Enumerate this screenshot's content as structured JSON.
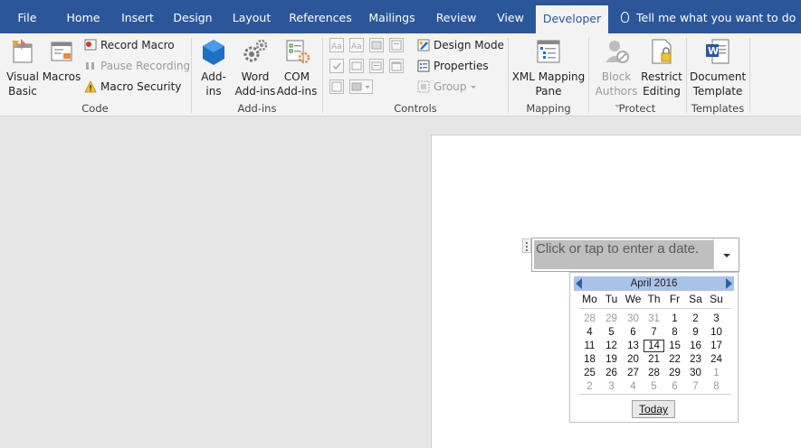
{
  "tabs": [
    {
      "label": "File"
    },
    {
      "label": "Home"
    },
    {
      "label": "Insert"
    },
    {
      "label": "Design"
    },
    {
      "label": "Layout"
    },
    {
      "label": "References"
    },
    {
      "label": "Mailings"
    },
    {
      "label": "Review"
    },
    {
      "label": "View"
    },
    {
      "label": "Developer"
    }
  ],
  "tell_me": "Tell me what you want to do",
  "colors": {
    "brand": "#2b579a",
    "ribbon": "#f3f3f3",
    "calendar_header": "#a9c3e8"
  },
  "ribbon": {
    "code": {
      "label": "Code",
      "visual_basic": [
        "Visual",
        "Basic"
      ],
      "macros": "Macros",
      "record_macro": "Record Macro",
      "pause_recording": "Pause Recording",
      "macro_security": "Macro Security"
    },
    "addins": {
      "label": "Add-ins",
      "addins": [
        "Add-",
        "ins"
      ],
      "word_addins": [
        "Word",
        "Add-ins"
      ],
      "com_addins": [
        "COM",
        "Add-ins"
      ]
    },
    "controls": {
      "label": "Controls",
      "design_mode": "Design Mode",
      "properties": "Properties",
      "group": "Group"
    },
    "mapping": {
      "label": "Mapping",
      "xml_mapping_pane": [
        "XML Mapping",
        "Pane"
      ]
    },
    "protect": {
      "label": "Protect",
      "block_authors": [
        "Block",
        "Authors"
      ],
      "restrict_editing": [
        "Restrict",
        "Editing"
      ]
    },
    "templates": {
      "label": "Templates",
      "document_template": [
        "Document",
        "Template"
      ]
    }
  },
  "date_control": {
    "placeholder": "Click or tap to enter a date."
  },
  "calendar": {
    "month": "April 2016",
    "weekdays": [
      "Mo",
      "Tu",
      "We",
      "Th",
      "Fr",
      "Sa",
      "Su"
    ],
    "weeks": [
      [
        "28",
        "29",
        "30",
        "31",
        "1",
        "2",
        "3"
      ],
      [
        "4",
        "5",
        "6",
        "7",
        "8",
        "9",
        "10"
      ],
      [
        "11",
        "12",
        "13",
        "14",
        "15",
        "16",
        "17"
      ],
      [
        "18",
        "19",
        "20",
        "21",
        "22",
        "23",
        "24"
      ],
      [
        "25",
        "26",
        "27",
        "28",
        "29",
        "30",
        "1"
      ],
      [
        "2",
        "3",
        "4",
        "5",
        "6",
        "7",
        "8"
      ]
    ],
    "today_label": "Today",
    "selected_day": "14"
  }
}
